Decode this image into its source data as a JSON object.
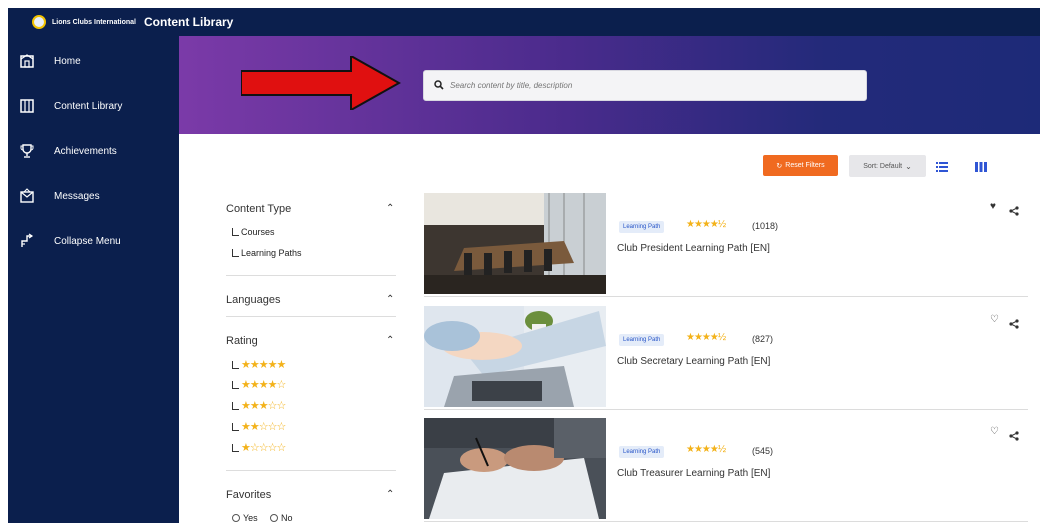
{
  "topbar": {
    "org_name": "Lions Clubs International",
    "app_title": "Content Library"
  },
  "sidebar": {
    "items": [
      {
        "label": "Home",
        "icon": "home-icon"
      },
      {
        "label": "Content Library",
        "icon": "library-icon"
      },
      {
        "label": "Achievements",
        "icon": "trophy-icon"
      },
      {
        "label": "Messages",
        "icon": "messages-icon"
      },
      {
        "label": "Collapse Menu",
        "icon": "collapse-icon"
      }
    ]
  },
  "search": {
    "placeholder": "Search content by title, description"
  },
  "toolbar": {
    "reset_label": "Reset Filters",
    "sort_label": "Sort: Default"
  },
  "filters": {
    "content_type": {
      "title": "Content Type",
      "options": [
        "Courses",
        "Learning Paths"
      ]
    },
    "languages": {
      "title": "Languages"
    },
    "rating": {
      "title": "Rating",
      "options": [
        "★★★★★",
        "★★★★☆",
        "★★★☆☆",
        "★★☆☆☆",
        "★☆☆☆☆"
      ]
    },
    "favorites": {
      "title": "Favorites",
      "options": [
        "Yes",
        "No"
      ]
    }
  },
  "cards": [
    {
      "badge": "Learning Path",
      "rating_stars": "★★★★½",
      "count": "(1018)",
      "title": "Club President Learning Path [EN]",
      "favorited": true
    },
    {
      "badge": "Learning Path",
      "rating_stars": "★★★★½",
      "count": "(827)",
      "title": "Club Secretary Learning Path [EN]",
      "favorited": false
    },
    {
      "badge": "Learning Path",
      "rating_stars": "★★★★½",
      "count": "(545)",
      "title": "Club Treasurer Learning Path [EN]",
      "favorited": false
    }
  ],
  "colors": {
    "navy": "#0b1f4d",
    "accent_orange": "#f06a20",
    "star": "#f3b21a",
    "badge_blue": "#2755c8",
    "arrow_red": "#e01010"
  }
}
